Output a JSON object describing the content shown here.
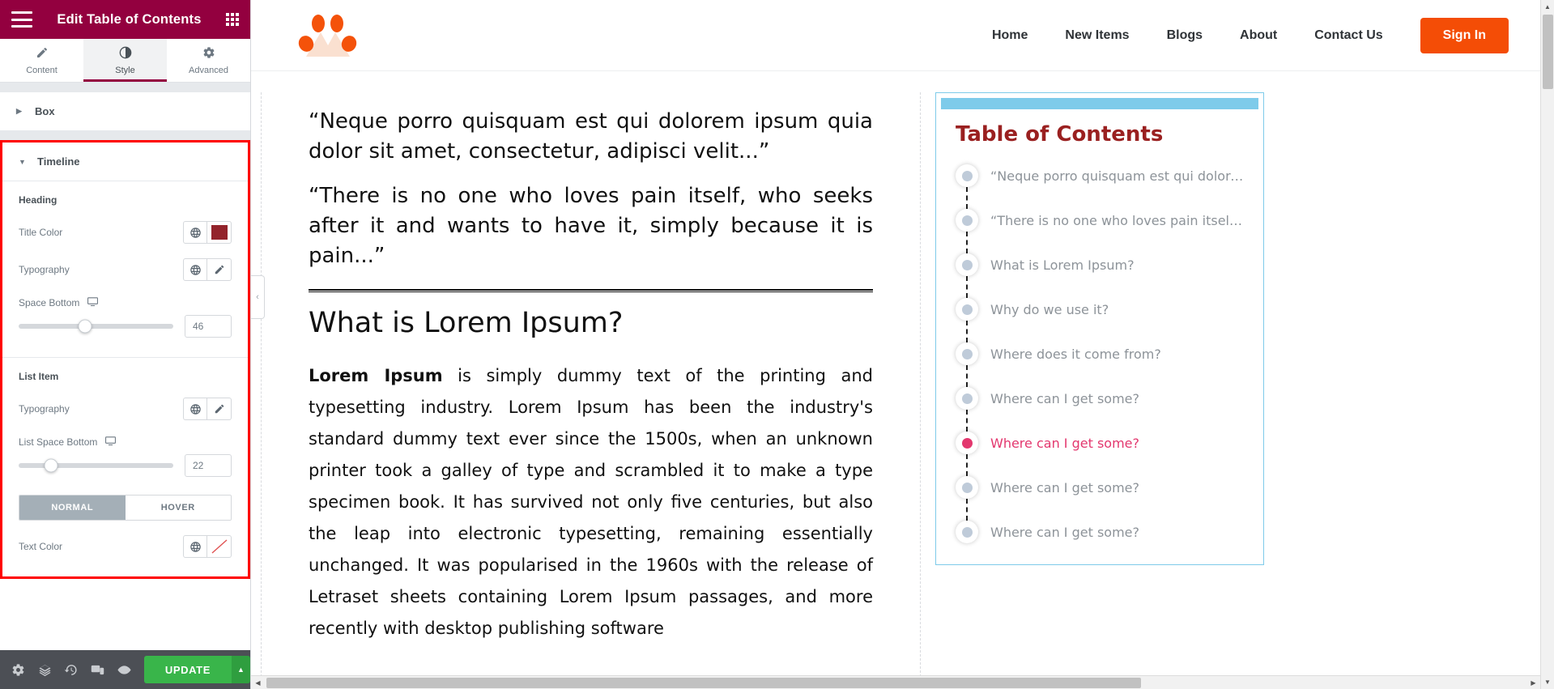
{
  "panel": {
    "title": "Edit Table of Contents",
    "menu_icon": "hamburger-icon",
    "grid_icon": "apps-grid-icon",
    "tabs": [
      {
        "label": "Content",
        "icon": "pencil-icon",
        "active": false
      },
      {
        "label": "Style",
        "icon": "contrast-icon",
        "active": true
      },
      {
        "label": "Advanced",
        "icon": "gear-icon",
        "active": false
      }
    ],
    "sections": [
      {
        "label": "Box",
        "expanded": false
      },
      {
        "label": "Timeline",
        "expanded": true
      }
    ],
    "timeline": {
      "heading_group": "Heading",
      "title_color": {
        "label": "Title Color",
        "globe_icon": "globe-icon",
        "swatch_color": "#93232b"
      },
      "heading_typography": {
        "label": "Typography",
        "globe_icon": "globe-icon",
        "edit_icon": "pencil-icon"
      },
      "space_bottom": {
        "label": "Space Bottom",
        "device_icon": "desktop-icon",
        "value": "46",
        "slider_percent": 43
      },
      "list_group": "List Item",
      "list_typography": {
        "label": "Typography",
        "globe_icon": "globe-icon",
        "edit_icon": "pencil-icon"
      },
      "list_space_bottom": {
        "label": "List Space Bottom",
        "device_icon": "desktop-icon",
        "value": "22",
        "slider_percent": 21
      },
      "state_tabs": [
        {
          "label": "NORMAL",
          "active": true
        },
        {
          "label": "HOVER",
          "active": false
        }
      ],
      "text_color": {
        "label": "Text Color",
        "globe_icon": "globe-icon",
        "swatch_color": "#ffffff"
      }
    },
    "footer": {
      "icons": [
        {
          "name": "settings-gear-icon"
        },
        {
          "name": "layers-navigator-icon"
        },
        {
          "name": "history-icon"
        },
        {
          "name": "responsive-mode-icon"
        },
        {
          "name": "preview-eye-icon"
        }
      ],
      "update_label": "UPDATE",
      "update_caret": "▲",
      "update_color": "#39b54a"
    },
    "collapse_handle": "‹"
  },
  "site": {
    "logo_name": "brand-logo",
    "nav": [
      {
        "label": "Home"
      },
      {
        "label": "New Items"
      },
      {
        "label": "Blogs"
      },
      {
        "label": "About"
      },
      {
        "label": "Contact Us"
      }
    ],
    "signin_label": "Sign In",
    "signin_color": "#f44d06"
  },
  "article": {
    "quote1": "“Neque porro quisquam est qui dolorem ipsum quia dolor sit amet, consectetur, adipisci velit...”",
    "quote2": "“There is no one who loves pain itself, who seeks after it and wants to have it, simply because it is pain...”",
    "heading": "What is Lorem Ipsum?",
    "body_lead": "Lorem Ipsum",
    "body_rest": " is simply dummy text of the printing and typesetting industry. Lorem Ipsum has been the industry's standard dummy text ever since the 1500s, when an unknown printer took a galley of type and scrambled it to make a type specimen book. It has survived not only five centuries, but also the leap into electronic typesetting, remaining essentially unchanged. It was popularised in the 1960s with the release of Letraset sheets containing Lorem Ipsum passages, and more recently with desktop publishing software"
  },
  "toc": {
    "title": "Table of Contents",
    "title_color": "#9a2020",
    "border_color": "#7ecbea",
    "active_color": "#e3376e",
    "items": [
      {
        "label": "“Neque porro quisquam est qui dolorem i...",
        "active": false
      },
      {
        "label": "“There is no one who loves pain itself, wh...",
        "active": false
      },
      {
        "label": "What is Lorem Ipsum?",
        "active": false
      },
      {
        "label": "Why do we use it?",
        "active": false
      },
      {
        "label": "Where does it come from?",
        "active": false
      },
      {
        "label": "Where can I get some?",
        "active": false
      },
      {
        "label": "Where can I get some?",
        "active": true
      },
      {
        "label": "Where can I get some?",
        "active": false
      },
      {
        "label": "Where can I get some?",
        "active": false
      }
    ]
  },
  "scrollbars": {
    "v_up": "▲",
    "v_down": "▼",
    "h_left": "◀",
    "h_right": "▶"
  }
}
